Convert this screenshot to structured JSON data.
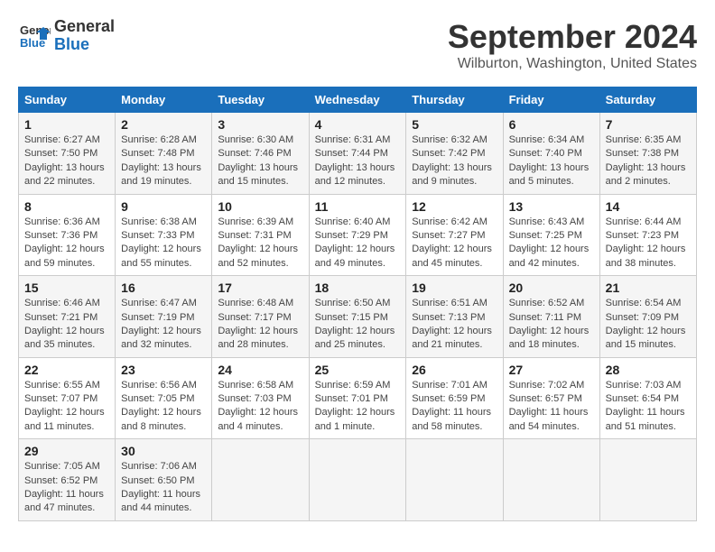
{
  "header": {
    "logo_line1": "General",
    "logo_line2": "Blue",
    "month": "September 2024",
    "location": "Wilburton, Washington, United States"
  },
  "weekdays": [
    "Sunday",
    "Monday",
    "Tuesday",
    "Wednesday",
    "Thursday",
    "Friday",
    "Saturday"
  ],
  "weeks": [
    [
      {
        "day": "1",
        "sunrise": "Sunrise: 6:27 AM",
        "sunset": "Sunset: 7:50 PM",
        "daylight": "Daylight: 13 hours and 22 minutes."
      },
      {
        "day": "2",
        "sunrise": "Sunrise: 6:28 AM",
        "sunset": "Sunset: 7:48 PM",
        "daylight": "Daylight: 13 hours and 19 minutes."
      },
      {
        "day": "3",
        "sunrise": "Sunrise: 6:30 AM",
        "sunset": "Sunset: 7:46 PM",
        "daylight": "Daylight: 13 hours and 15 minutes."
      },
      {
        "day": "4",
        "sunrise": "Sunrise: 6:31 AM",
        "sunset": "Sunset: 7:44 PM",
        "daylight": "Daylight: 13 hours and 12 minutes."
      },
      {
        "day": "5",
        "sunrise": "Sunrise: 6:32 AM",
        "sunset": "Sunset: 7:42 PM",
        "daylight": "Daylight: 13 hours and 9 minutes."
      },
      {
        "day": "6",
        "sunrise": "Sunrise: 6:34 AM",
        "sunset": "Sunset: 7:40 PM",
        "daylight": "Daylight: 13 hours and 5 minutes."
      },
      {
        "day": "7",
        "sunrise": "Sunrise: 6:35 AM",
        "sunset": "Sunset: 7:38 PM",
        "daylight": "Daylight: 13 hours and 2 minutes."
      }
    ],
    [
      {
        "day": "8",
        "sunrise": "Sunrise: 6:36 AM",
        "sunset": "Sunset: 7:36 PM",
        "daylight": "Daylight: 12 hours and 59 minutes."
      },
      {
        "day": "9",
        "sunrise": "Sunrise: 6:38 AM",
        "sunset": "Sunset: 7:33 PM",
        "daylight": "Daylight: 12 hours and 55 minutes."
      },
      {
        "day": "10",
        "sunrise": "Sunrise: 6:39 AM",
        "sunset": "Sunset: 7:31 PM",
        "daylight": "Daylight: 12 hours and 52 minutes."
      },
      {
        "day": "11",
        "sunrise": "Sunrise: 6:40 AM",
        "sunset": "Sunset: 7:29 PM",
        "daylight": "Daylight: 12 hours and 49 minutes."
      },
      {
        "day": "12",
        "sunrise": "Sunrise: 6:42 AM",
        "sunset": "Sunset: 7:27 PM",
        "daylight": "Daylight: 12 hours and 45 minutes."
      },
      {
        "day": "13",
        "sunrise": "Sunrise: 6:43 AM",
        "sunset": "Sunset: 7:25 PM",
        "daylight": "Daylight: 12 hours and 42 minutes."
      },
      {
        "day": "14",
        "sunrise": "Sunrise: 6:44 AM",
        "sunset": "Sunset: 7:23 PM",
        "daylight": "Daylight: 12 hours and 38 minutes."
      }
    ],
    [
      {
        "day": "15",
        "sunrise": "Sunrise: 6:46 AM",
        "sunset": "Sunset: 7:21 PM",
        "daylight": "Daylight: 12 hours and 35 minutes."
      },
      {
        "day": "16",
        "sunrise": "Sunrise: 6:47 AM",
        "sunset": "Sunset: 7:19 PM",
        "daylight": "Daylight: 12 hours and 32 minutes."
      },
      {
        "day": "17",
        "sunrise": "Sunrise: 6:48 AM",
        "sunset": "Sunset: 7:17 PM",
        "daylight": "Daylight: 12 hours and 28 minutes."
      },
      {
        "day": "18",
        "sunrise": "Sunrise: 6:50 AM",
        "sunset": "Sunset: 7:15 PM",
        "daylight": "Daylight: 12 hours and 25 minutes."
      },
      {
        "day": "19",
        "sunrise": "Sunrise: 6:51 AM",
        "sunset": "Sunset: 7:13 PM",
        "daylight": "Daylight: 12 hours and 21 minutes."
      },
      {
        "day": "20",
        "sunrise": "Sunrise: 6:52 AM",
        "sunset": "Sunset: 7:11 PM",
        "daylight": "Daylight: 12 hours and 18 minutes."
      },
      {
        "day": "21",
        "sunrise": "Sunrise: 6:54 AM",
        "sunset": "Sunset: 7:09 PM",
        "daylight": "Daylight: 12 hours and 15 minutes."
      }
    ],
    [
      {
        "day": "22",
        "sunrise": "Sunrise: 6:55 AM",
        "sunset": "Sunset: 7:07 PM",
        "daylight": "Daylight: 12 hours and 11 minutes."
      },
      {
        "day": "23",
        "sunrise": "Sunrise: 6:56 AM",
        "sunset": "Sunset: 7:05 PM",
        "daylight": "Daylight: 12 hours and 8 minutes."
      },
      {
        "day": "24",
        "sunrise": "Sunrise: 6:58 AM",
        "sunset": "Sunset: 7:03 PM",
        "daylight": "Daylight: 12 hours and 4 minutes."
      },
      {
        "day": "25",
        "sunrise": "Sunrise: 6:59 AM",
        "sunset": "Sunset: 7:01 PM",
        "daylight": "Daylight: 12 hours and 1 minute."
      },
      {
        "day": "26",
        "sunrise": "Sunrise: 7:01 AM",
        "sunset": "Sunset: 6:59 PM",
        "daylight": "Daylight: 11 hours and 58 minutes."
      },
      {
        "day": "27",
        "sunrise": "Sunrise: 7:02 AM",
        "sunset": "Sunset: 6:57 PM",
        "daylight": "Daylight: 11 hours and 54 minutes."
      },
      {
        "day": "28",
        "sunrise": "Sunrise: 7:03 AM",
        "sunset": "Sunset: 6:54 PM",
        "daylight": "Daylight: 11 hours and 51 minutes."
      }
    ],
    [
      {
        "day": "29",
        "sunrise": "Sunrise: 7:05 AM",
        "sunset": "Sunset: 6:52 PM",
        "daylight": "Daylight: 11 hours and 47 minutes."
      },
      {
        "day": "30",
        "sunrise": "Sunrise: 7:06 AM",
        "sunset": "Sunset: 6:50 PM",
        "daylight": "Daylight: 11 hours and 44 minutes."
      },
      null,
      null,
      null,
      null,
      null
    ]
  ]
}
